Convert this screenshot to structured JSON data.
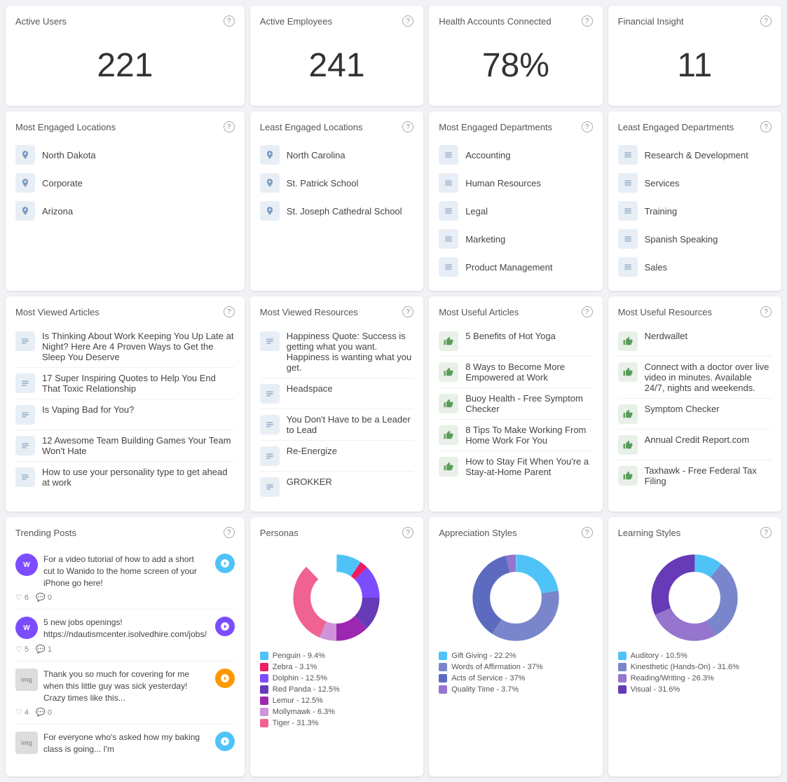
{
  "stats": [
    {
      "title": "Active Users",
      "value": "221"
    },
    {
      "title": "Active Employees",
      "value": "241"
    },
    {
      "title": "Health Accounts Connected",
      "value": "78%"
    },
    {
      "title": "Financial Insight",
      "value": "11"
    }
  ],
  "mostEngagedLocations": {
    "title": "Most Engaged Locations",
    "items": [
      "North Dakota",
      "Corporate",
      "Arizona"
    ]
  },
  "leastEngagedLocations": {
    "title": "Least Engaged Locations",
    "items": [
      "North Carolina",
      "St. Patrick School",
      "St. Joseph Cathedral School"
    ]
  },
  "mostEngagedDepartments": {
    "title": "Most Engaged Departments",
    "items": [
      "Accounting",
      "Human Resources",
      "Legal",
      "Marketing",
      "Product Management"
    ]
  },
  "leastEngagedDepartments": {
    "title": "Least Engaged Departments",
    "items": [
      "Research & Development",
      "Services",
      "Training",
      "Spanish Speaking",
      "Sales"
    ]
  },
  "mostViewedArticles": {
    "title": "Most Viewed Articles",
    "items": [
      "Is Thinking About Work Keeping You Up Late at Night? Here Are 4 Proven Ways to Get the Sleep You Deserve",
      "17 Super Inspiring Quotes to Help You End That Toxic Relationship",
      "Is Vaping Bad for You?",
      "12 Awesome Team Building Games Your Team Won't Hate",
      "How to use your personality type to get ahead at work"
    ]
  },
  "mostViewedResources": {
    "title": "Most Viewed Resources",
    "items": [
      "Happiness Quote: Success is getting what you want. Happiness is wanting what you get.",
      "Headspace",
      "You Don't Have to be a Leader to Lead",
      "Re-Energize",
      "GROKKER"
    ]
  },
  "mostUsefulArticles": {
    "title": "Most Useful Articles",
    "items": [
      "5 Benefits of Hot Yoga",
      "8 Ways to Become More Empowered at Work",
      "Buoy Health - Free Symptom Checker",
      "8 Tips To Make Working From Home Work For You",
      "How to Stay Fit When You're a Stay-at-Home Parent"
    ]
  },
  "mostUsefulResources": {
    "title": "Most Useful Resources",
    "items": [
      "Nerdwallet",
      "Connect with a doctor over live video in minutes. Available 24/7, nights and weekends.",
      "Symptom Checker",
      "Annual Credit Report.com",
      "Taxhawk - Free Federal Tax Filing"
    ]
  },
  "trendingPosts": {
    "title": "Trending Posts",
    "posts": [
      {
        "content": "For a video tutorial of how to add a short cut to Wanido to the home screen of your iPhone go here!",
        "likes": "6",
        "comments": "0",
        "badge_color": "blue"
      },
      {
        "content": "5 new jobs openings! https://ndautismcenter.isolvedhire.com/jobs/",
        "likes": "5",
        "comments": "1",
        "badge_color": "purple"
      },
      {
        "content": "Thank you so much for covering for me when this little guy was sick yesterday! Crazy times like this...",
        "likes": "4",
        "comments": "0",
        "badge_color": "orange"
      },
      {
        "content": "For everyone who's asked how my baking class is going... I'm",
        "likes": "",
        "comments": "",
        "badge_color": "blue"
      }
    ]
  },
  "personas": {
    "title": "Personas",
    "segments": [
      {
        "label": "Penguin - 9.4%",
        "value": 9.4,
        "color": "#4fc3f7"
      },
      {
        "label": "Zebra - 3.1%",
        "value": 3.1,
        "color": "#e91e63"
      },
      {
        "label": "Dolphin - 12.5%",
        "value": 12.5,
        "color": "#7c4dff"
      },
      {
        "label": "Red Panda - 12.5%",
        "value": 12.5,
        "color": "#673ab7"
      },
      {
        "label": "Lemur - 12.5%",
        "value": 12.5,
        "color": "#9c27b0"
      },
      {
        "label": "Mollymawk - 6.3%",
        "value": 6.3,
        "color": "#ce93d8"
      },
      {
        "label": "Tiger - 31.3%",
        "value": 31.3,
        "color": "#f06292"
      }
    ]
  },
  "appreciationStyles": {
    "title": "Appreciation Styles",
    "segments": [
      {
        "label": "Gift Giving - 22.2%",
        "value": 22.2,
        "color": "#4fc3f7"
      },
      {
        "label": "Words of Affirmation - 37%",
        "value": 37,
        "color": "#7986cb"
      },
      {
        "label": "Acts of Service - 37%",
        "value": 37,
        "color": "#5c6bc0"
      },
      {
        "label": "Quality Time - 3.7%",
        "value": 3.7,
        "color": "#9575cd"
      }
    ]
  },
  "learningStyles": {
    "title": "Learning Styles",
    "segments": [
      {
        "label": "Auditory - 10.5%",
        "value": 10.5,
        "color": "#4fc3f7"
      },
      {
        "label": "Kinesthetic (Hands-On) - 31.6%",
        "value": 31.6,
        "color": "#7986cb"
      },
      {
        "label": "Reading/Writing - 26.3%",
        "value": 26.3,
        "color": "#9575cd"
      },
      {
        "label": "Visual - 31.6%",
        "value": 31.6,
        "color": "#673ab7"
      }
    ]
  }
}
